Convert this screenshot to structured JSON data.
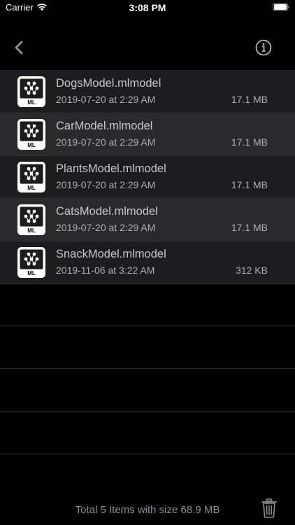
{
  "status_bar": {
    "carrier": "Carrier",
    "time": "3:08 PM"
  },
  "nav": {
    "back_icon": "chevron-left-icon",
    "info_icon": "info-circle-icon"
  },
  "files": [
    {
      "name": "DogsModel.mlmodel",
      "date": "2019-07-20 at 2:29 AM",
      "size": "17.1 MB",
      "icon_label": "ML"
    },
    {
      "name": "CarModel.mlmodel",
      "date": "2019-07-20 at 2:29 AM",
      "size": "17.1 MB",
      "icon_label": "ML"
    },
    {
      "name": "PlantsModel.mlmodel",
      "date": "2019-07-20 at 2:29 AM",
      "size": "17.1 MB",
      "icon_label": "ML"
    },
    {
      "name": "CatsModel.mlmodel",
      "date": "2019-07-20 at 2:29 AM",
      "size": "17.1 MB",
      "icon_label": "ML"
    },
    {
      "name": "SnackModel.mlmodel",
      "date": "2019-11-06 at 3:22 AM",
      "size": "312 KB",
      "icon_label": "ML"
    }
  ],
  "footer": {
    "total_text": "Total 5 Items with size 68.9 MB",
    "trash_icon": "trash-icon"
  },
  "colors": {
    "background": "#000000",
    "row_odd": "#1c1c1e",
    "row_even": "#2a2a2c",
    "primary_text": "#c8c8cc",
    "secondary_text": "#aeaeb2",
    "footer_text": "#8e8e93"
  }
}
